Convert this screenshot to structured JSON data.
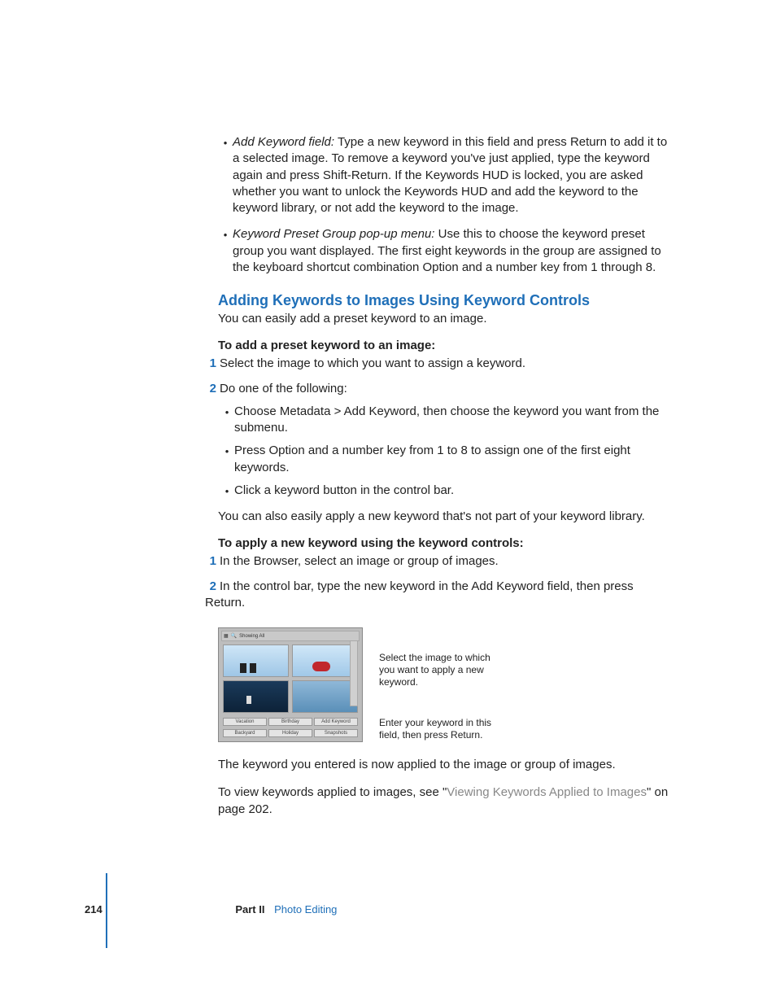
{
  "bullets": {
    "b1_head": "Add Keyword field:",
    "b1_body": " Type a new keyword in this field and press Return to add it to a selected image. To remove a keyword you've just applied, type the keyword again and press Shift-Return. If the Keywords HUD is locked, you are asked whether you want to unlock the Keywords HUD and add the keyword to the keyword library, or not add the keyword to the image.",
    "b2_head": "Keyword Preset Group pop-up menu:",
    "b2_body": " Use this to choose the keyword preset group you want displayed. The first eight keywords in the group are assigned to the keyboard shortcut combination Option and a number key from 1 through 8."
  },
  "section_heading": "Adding Keywords to Images Using Keyword Controls",
  "intro_para": "You can easily add a preset keyword to an image.",
  "task1_title": "To add a preset keyword to an image:",
  "task1_step1": "Select the image to which you want to assign a keyword.",
  "task1_step2": "Do one of the following:",
  "task1_sub1": "Choose Metadata > Add Keyword, then choose the keyword you want from the submenu.",
  "task1_sub2": "Press Option and a number key from 1 to 8 to assign one of the first eight keywords.",
  "task1_sub3": "Click a keyword button in the control bar.",
  "mid_para": "You can also easily apply a new keyword that's not part of your keyword library.",
  "task2_title": "To apply a new keyword using the keyword controls:",
  "task2_step1": "In the Browser, select an image or group of images.",
  "task2_step2": "In the control bar, type the new keyword in the Add Keyword field, then press Return.",
  "figure": {
    "topbar_label": "Showing All",
    "buttons": [
      "Vacation",
      "Birthday",
      "Add Keyword"
    ],
    "buttons2": [
      "Backyard",
      "Holiday",
      "Snapshots"
    ],
    "callout1": "Select the image to which you want to apply a new keyword.",
    "callout2": "Enter your keyword in this field, then press Return."
  },
  "closing_para": "The keyword you entered is now applied to the image or group of images.",
  "xref_pre": "To view keywords applied to images, see \"",
  "xref_link": "Viewing Keywords Applied to Images",
  "xref_post": "\" on page 202.",
  "footer": {
    "page_number": "214",
    "part_label": "Part II",
    "section_name": "Photo Editing"
  }
}
